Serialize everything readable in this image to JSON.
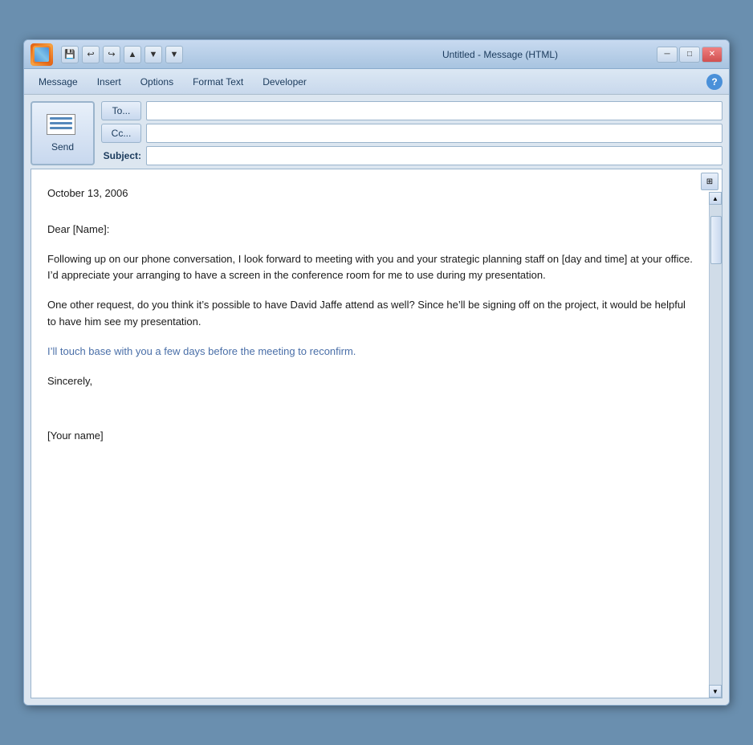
{
  "window": {
    "title": "Untitled - Message (HTML)",
    "minimize_label": "─",
    "restore_label": "□",
    "close_label": "✕"
  },
  "quickaccess": {
    "save_label": "💾",
    "undo_label": "↩",
    "redo_label": "↪",
    "up_label": "▲",
    "down_label": "▼",
    "dropdown_label": "▼"
  },
  "menu": {
    "items": [
      "Message",
      "Insert",
      "Options",
      "Format Text",
      "Developer"
    ],
    "help_label": "?"
  },
  "compose": {
    "send_label": "Send",
    "to_label": "To...",
    "cc_label": "Cc...",
    "subject_label": "Subject:",
    "to_value": "",
    "cc_value": "",
    "subject_value": "",
    "to_placeholder": "",
    "cc_placeholder": "",
    "subject_placeholder": ""
  },
  "body": {
    "date": "October 13, 2006",
    "salutation": "Dear [Name]:",
    "paragraph1": "Following up on our phone conversation, I look forward to meeting with you and your strategic planning staff on [day and time] at your office. I’d appreciate your arranging to have a screen in the conference room for me to use during my presentation.",
    "paragraph2": "One other request, do you think it’s possible to have David Jaffe attend as well? Since he’ll be signing off on the project, it would be helpful to have him see my presentation.",
    "paragraph3": "I’ll touch base with you a few days before the meeting to reconfirm.",
    "closing": "Sincerely,",
    "signature": "[Your name]"
  },
  "scrollbar": {
    "up_arrow": "▲",
    "down_arrow": "▼"
  }
}
